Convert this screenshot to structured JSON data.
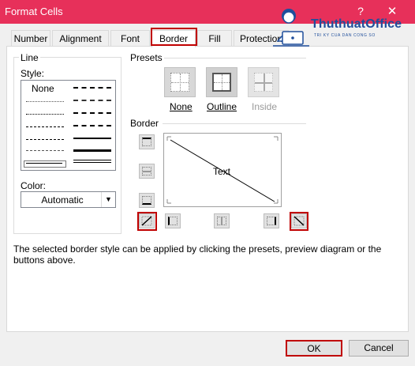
{
  "window": {
    "title": "Format Cells",
    "help_glyph": "?",
    "close_glyph": "✕"
  },
  "watermark": {
    "brand": "ThuthuatOffice",
    "tagline": "TRI KY CUA DAN CONG SO"
  },
  "tabs": [
    {
      "label": "Number"
    },
    {
      "label": "Alignment"
    },
    {
      "label": "Font"
    },
    {
      "label": "Border",
      "active": true
    },
    {
      "label": "Fill"
    },
    {
      "label": "Protection"
    }
  ],
  "line_group": {
    "title": "Line",
    "style_label": "Style:",
    "none_label": "None",
    "color_label": "Color:",
    "color_value": "Automatic"
  },
  "presets": {
    "title": "Presets",
    "items": [
      {
        "label": "None"
      },
      {
        "label": "Outline"
      },
      {
        "label": "Inside",
        "disabled": true
      }
    ]
  },
  "border": {
    "title": "Border",
    "preview_text": "Text"
  },
  "description": "The selected border style can be applied by clicking the presets, preview diagram or the buttons above.",
  "buttons": {
    "ok": "OK",
    "cancel": "Cancel"
  },
  "colors": {
    "titlebar": "#e7305a",
    "highlight": "#c00000",
    "brand": "#1f4e9b"
  }
}
